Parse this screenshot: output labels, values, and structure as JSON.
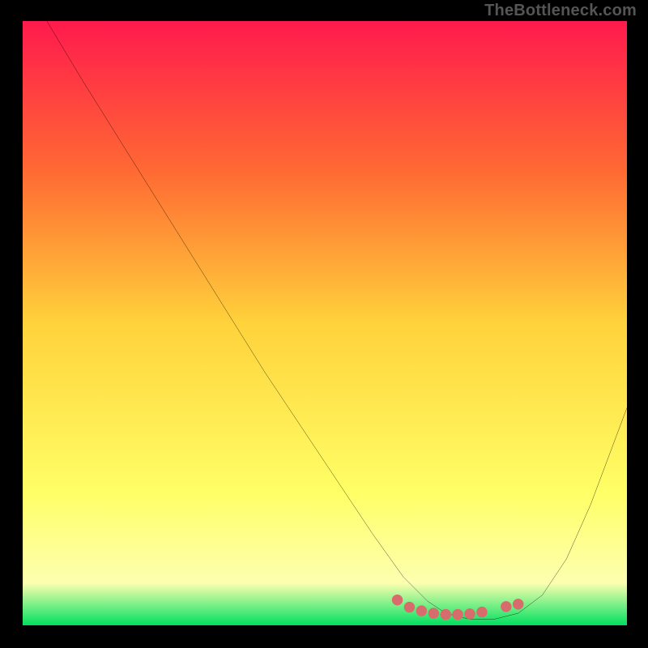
{
  "attribution": "TheBottleneck.com",
  "chart_data": {
    "type": "line",
    "title": "",
    "xlabel": "",
    "ylabel": "",
    "xlim": [
      0,
      100
    ],
    "ylim": [
      0,
      100
    ],
    "background_gradient": {
      "stops": [
        {
          "offset": 0,
          "color": "#ff1a4d"
        },
        {
          "offset": 25,
          "color": "#ff6a33"
        },
        {
          "offset": 50,
          "color": "#ffd23b"
        },
        {
          "offset": 78,
          "color": "#ffff66"
        },
        {
          "offset": 93,
          "color": "#fdffb0"
        },
        {
          "offset": 100,
          "color": "#00e060"
        }
      ]
    },
    "series": [
      {
        "name": "bottleneck-curve",
        "color": "#000000",
        "x": [
          4,
          10,
          20,
          30,
          40,
          50,
          58,
          63,
          67,
          70,
          74,
          78,
          82,
          86,
          90,
          94,
          97,
          100
        ],
        "y": [
          100,
          90,
          74,
          58,
          42,
          27,
          15,
          8,
          4,
          2,
          1,
          1,
          2,
          5,
          11,
          20,
          28,
          36
        ]
      }
    ],
    "markers": {
      "name": "optimal-range",
      "color": "#d86c6c",
      "points": [
        {
          "x": 62,
          "y": 4.2
        },
        {
          "x": 64,
          "y": 3.0
        },
        {
          "x": 66,
          "y": 2.4
        },
        {
          "x": 68,
          "y": 2.0
        },
        {
          "x": 70,
          "y": 1.8
        },
        {
          "x": 72,
          "y": 1.8
        },
        {
          "x": 74,
          "y": 1.9
        },
        {
          "x": 76,
          "y": 2.2
        },
        {
          "x": 80,
          "y": 3.1
        },
        {
          "x": 82,
          "y": 3.5
        }
      ]
    }
  }
}
